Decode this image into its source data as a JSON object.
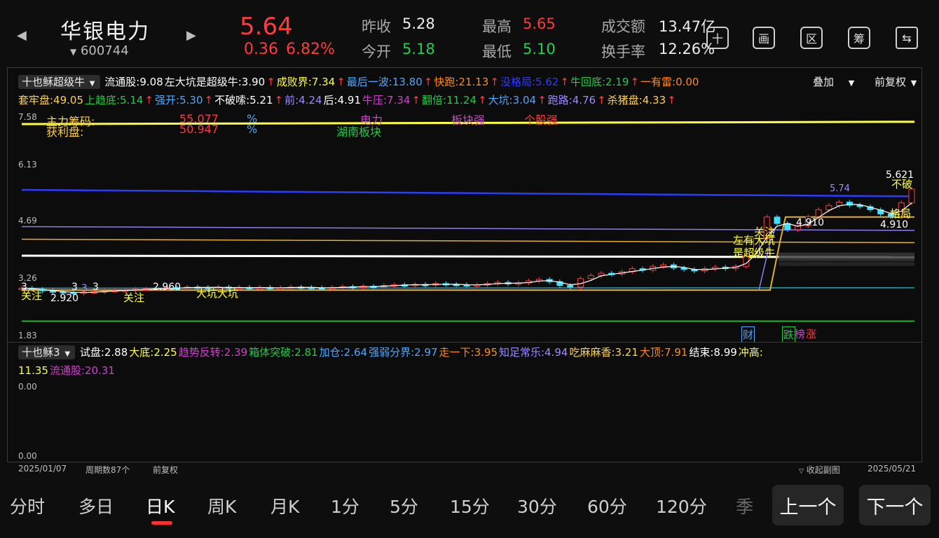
{
  "header": {
    "stock_name": "华银电力",
    "stock_code": "600744",
    "price": "5.64",
    "change": "0.36",
    "change_pct": "6.82%",
    "prev_close_label": "昨收",
    "prev_close": "5.28",
    "open_label": "今开",
    "open": "5.18",
    "high_label": "最高",
    "high": "5.65",
    "low_label": "最低",
    "low": "5.10",
    "turnover_label": "成交额",
    "turnover": "13.47亿",
    "turnover_rate_label": "换手率",
    "turnover_rate": "12.26%",
    "icons": [
      "plus-icon",
      "drawing-icon",
      "range-icon",
      "chips-icon",
      "device-switch-icon"
    ],
    "icon_glyphs": [
      "十",
      "画",
      "区",
      "筹",
      "⇆"
    ]
  },
  "main_panel": {
    "indicator_name": "十也稣超级牛",
    "overlay_label": "叠加",
    "adjust_label": "前复权",
    "row1": [
      {
        "text": "流通股:9.08",
        "color": "#ffffff",
        "arrow": ""
      },
      {
        "text": "左大坑是超级牛:3.90",
        "color": "#ffffff",
        "arrow": "↑"
      },
      {
        "text": "成败界:7.34",
        "color": "#ffff3a",
        "arrow": "↑"
      },
      {
        "text": "最后一波:13.80",
        "color": "#4ea8ff",
        "arrow": "↑"
      },
      {
        "text": "快跑:21.13",
        "color": "#ff8c1a",
        "arrow": "↑"
      },
      {
        "text": "没格局:5.62",
        "color": "#2c3cff",
        "arrow": "↑"
      },
      {
        "text": "牛回底:2.19",
        "color": "#22cc44",
        "arrow": "↑"
      },
      {
        "text": "一有雷:0.00",
        "color": "#ff8c1a",
        "arrow": ""
      }
    ],
    "row2": [
      {
        "text": "套牢盘:49.05",
        "color": "#ffd24a",
        "arrow": ""
      },
      {
        "text": "上趋底:5.14",
        "color": "#22cc44",
        "arrow": "↑"
      },
      {
        "text": "强开:5.30",
        "color": "#4ea8ff",
        "arrow": "↑"
      },
      {
        "text": "不破嗦:5.21",
        "color": "#ffffff",
        "arrow": "↑"
      },
      {
        "text": "前:4.24",
        "color": "#9b8cff",
        "arrow": ""
      },
      {
        "text": "后:4.91",
        "color": "#ffffff",
        "arrow": ""
      },
      {
        "text": "牛压:7.34",
        "color": "#d040d0",
        "arrow": "↑"
      },
      {
        "text": "翻倍:11.24",
        "color": "#22cc44",
        "arrow": "↑"
      },
      {
        "text": "大坑:3.04",
        "color": "#4ea8ff",
        "arrow": "↑"
      },
      {
        "text": "跑路:4.76",
        "color": "#9b8cff",
        "arrow": "↑"
      },
      {
        "text": "杀猪盘:4.33",
        "color": "#ffd24a",
        "arrow": "↑"
      }
    ],
    "y_ticks": [
      "7.58",
      "6.13",
      "4.69",
      "3.26",
      "1.83"
    ],
    "overlay_texts": {
      "main_chips": "主力筹码:",
      "main_chips_val": "55.077",
      "profit": "获利盘:",
      "profit_val": "50.947",
      "pct": "%",
      "pct2": "%",
      "sector": "电力",
      "region": "湖南板块",
      "sector_strong": "板块强",
      "stock_strong": "个股强"
    },
    "annotations": {
      "a1": "3",
      "a2": "3",
      "a3": "3",
      "a4": "3",
      "attn1": "关注",
      "low_price": "2.920",
      "attn2": "关注",
      "mid_price": "2.960",
      "big_pit": "大坑",
      "big_pit2": "大坑",
      "left_pit": "左有大坑",
      "super_bull": "是超级牛",
      "attn3": "关注",
      "p4910a": "4.910",
      "p4910b": "4.910",
      "p574": "5.74",
      "p5621": "5.621",
      "no_break": "不破",
      "pattern": "格局",
      "cai": "财",
      "die": "跌",
      "bang": "榜",
      "zhang": "涨"
    }
  },
  "sub_panel": {
    "indicator_name": "十也稣3",
    "items": [
      {
        "text": "试盘:2.88",
        "color": "#ffffff"
      },
      {
        "text": "大底:2.25",
        "color": "#ffff3a"
      },
      {
        "text": "趋势反转:2.39",
        "color": "#d040d0"
      },
      {
        "text": "箱体突破:2.81",
        "color": "#22cc44"
      },
      {
        "text": "加仓:2.64",
        "color": "#4ea8ff"
      },
      {
        "text": "强弱分界:2.97",
        "color": "#4ea8ff"
      },
      {
        "text": "走一下:3.95",
        "color": "#ff8c1a"
      },
      {
        "text": "知足常乐:4.94",
        "color": "#9b8cff"
      },
      {
        "text": "吃麻麻香:3.21",
        "color": "#ffd24a"
      },
      {
        "text": "大顶:7.91",
        "color": "#ff8c1a"
      },
      {
        "text": "结束:8.99",
        "color": "#ffffff"
      },
      {
        "text": "冲高:",
        "color": "#ffff3a"
      }
    ],
    "items_row2": [
      {
        "text": "11.35",
        "color": "#ffff3a"
      },
      {
        "text": "流通股:20.31",
        "color": "#d040d0"
      }
    ],
    "y_ticks": [
      "0.00",
      "0.00"
    ]
  },
  "footer_axis": {
    "start_date": "2025/01/07",
    "period_count": "周期数87个",
    "adjust": "前复权",
    "collapse": "收起副图",
    "end_date": "2025/05/21"
  },
  "tabs": [
    "分时",
    "多日",
    "日K",
    "周K",
    "月K",
    "1分",
    "5分",
    "15分",
    "30分",
    "60分",
    "120分",
    "季"
  ],
  "active_tab": "日K",
  "nav": {
    "prev": "上一个",
    "next": "下一个"
  },
  "colors": {
    "up": "#ff3b3b",
    "down": "#3de0ff",
    "accent_tab": "#ff3030"
  },
  "chart_data": {
    "type": "candlestick",
    "title": "",
    "ylim": [
      1.83,
      7.58
    ],
    "x_range": [
      "2025/01/07",
      "2025/05/21"
    ],
    "periods": 87,
    "close_approx": [
      3.05,
      3.02,
      2.98,
      2.96,
      2.94,
      2.92,
      2.95,
      2.96,
      2.98,
      2.99,
      3.0,
      3.02,
      3.03,
      3.04,
      3.06,
      3.05,
      3.08,
      3.07,
      3.06,
      3.08,
      3.05,
      3.07,
      3.06,
      3.07,
      3.05,
      3.06,
      3.08,
      3.07,
      3.06,
      3.05,
      3.07,
      3.09,
      3.08,
      3.1,
      3.09,
      3.12,
      3.14,
      3.13,
      3.15,
      3.13,
      3.17,
      3.15,
      3.14,
      3.13,
      3.14,
      3.17,
      3.2,
      3.16,
      3.19,
      3.24,
      3.28,
      3.22,
      3.12,
      3.08,
      3.3,
      3.38,
      3.44,
      3.42,
      3.48,
      3.56,
      3.52,
      3.62,
      3.66,
      3.58,
      3.54,
      3.5,
      3.56,
      3.6,
      3.56,
      3.62,
      3.9,
      4.35,
      4.91,
      4.74,
      4.58,
      4.68,
      4.92,
      5.1,
      5.21,
      5.3,
      5.22,
      5.18,
      5.1,
      4.99,
      4.92,
      5.28,
      5.64
    ],
    "lines": [
      {
        "name": "没格局",
        "value": 5.62,
        "color": "#2c3cff"
      },
      {
        "name": "成败界",
        "value": 7.34,
        "color": "#ffff3a"
      },
      {
        "name": "前",
        "value": 4.24,
        "color": "#ffffff"
      },
      {
        "name": "杀猪盘",
        "value": 4.33,
        "color": "#ffd24a"
      },
      {
        "name": "牛回底",
        "value": 2.19,
        "color": "#22cc44"
      }
    ]
  }
}
